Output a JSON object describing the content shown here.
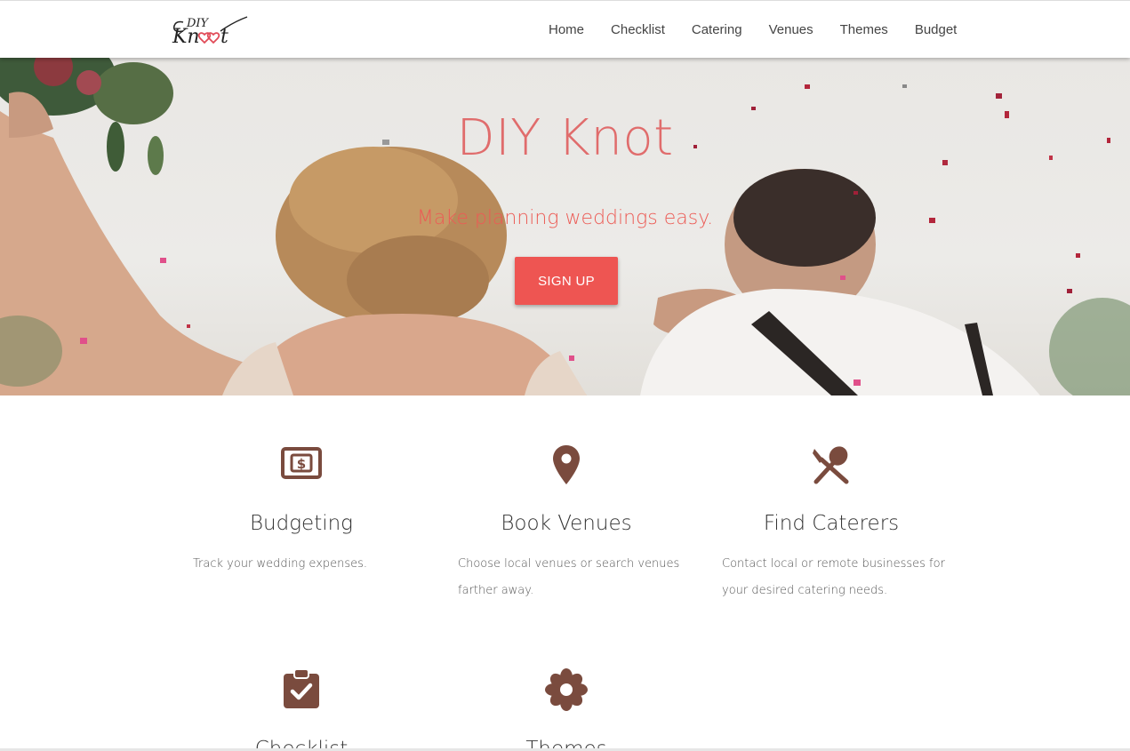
{
  "header": {
    "logo_text": "DIY Knot",
    "nav": [
      "Home",
      "Checklist",
      "Catering",
      "Venues",
      "Themes",
      "Budget"
    ]
  },
  "hero": {
    "title": "DIY Knot",
    "subtitle": "Make planning weddings easy.",
    "cta_label": "SIGN UP"
  },
  "features": [
    {
      "icon": "dollar-bill-icon",
      "title": "Budgeting",
      "description": "Track your wedding expenses."
    },
    {
      "icon": "map-pin-icon",
      "title": "Book Venues",
      "description": "Choose local venues or search venues farther away."
    },
    {
      "icon": "utensils-icon",
      "title": "Find Caterers",
      "description": "Contact local or remote businesses for your desired catering needs."
    },
    {
      "icon": "clipboard-check-icon",
      "title": "Checklist",
      "description": ""
    },
    {
      "icon": "flower-icon",
      "title": "Themes",
      "description": ""
    }
  ],
  "colors": {
    "accent": "#ee5552",
    "title_pink": "#e06c6c",
    "icon_brown": "#7a4b3e"
  }
}
